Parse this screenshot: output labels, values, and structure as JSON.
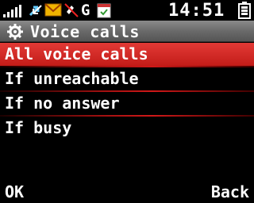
{
  "status": {
    "network": "G",
    "time": "14:51"
  },
  "header": {
    "title": "Voice calls"
  },
  "menu": {
    "items": [
      {
        "label": "All voice calls"
      },
      {
        "label": "If unreachable"
      },
      {
        "label": "If no answer"
      },
      {
        "label": "If busy"
      }
    ]
  },
  "softkeys": {
    "left": "OK",
    "right": "Back"
  },
  "colors": {
    "selection": "#d42a26",
    "titlebar": "#6f6f6f",
    "background": "#000000"
  },
  "icons": [
    "signal-icon",
    "data-arrows-icon",
    "message-icon",
    "mute-icon",
    "calendar-icon",
    "battery-icon",
    "settings-gear-icon"
  ]
}
